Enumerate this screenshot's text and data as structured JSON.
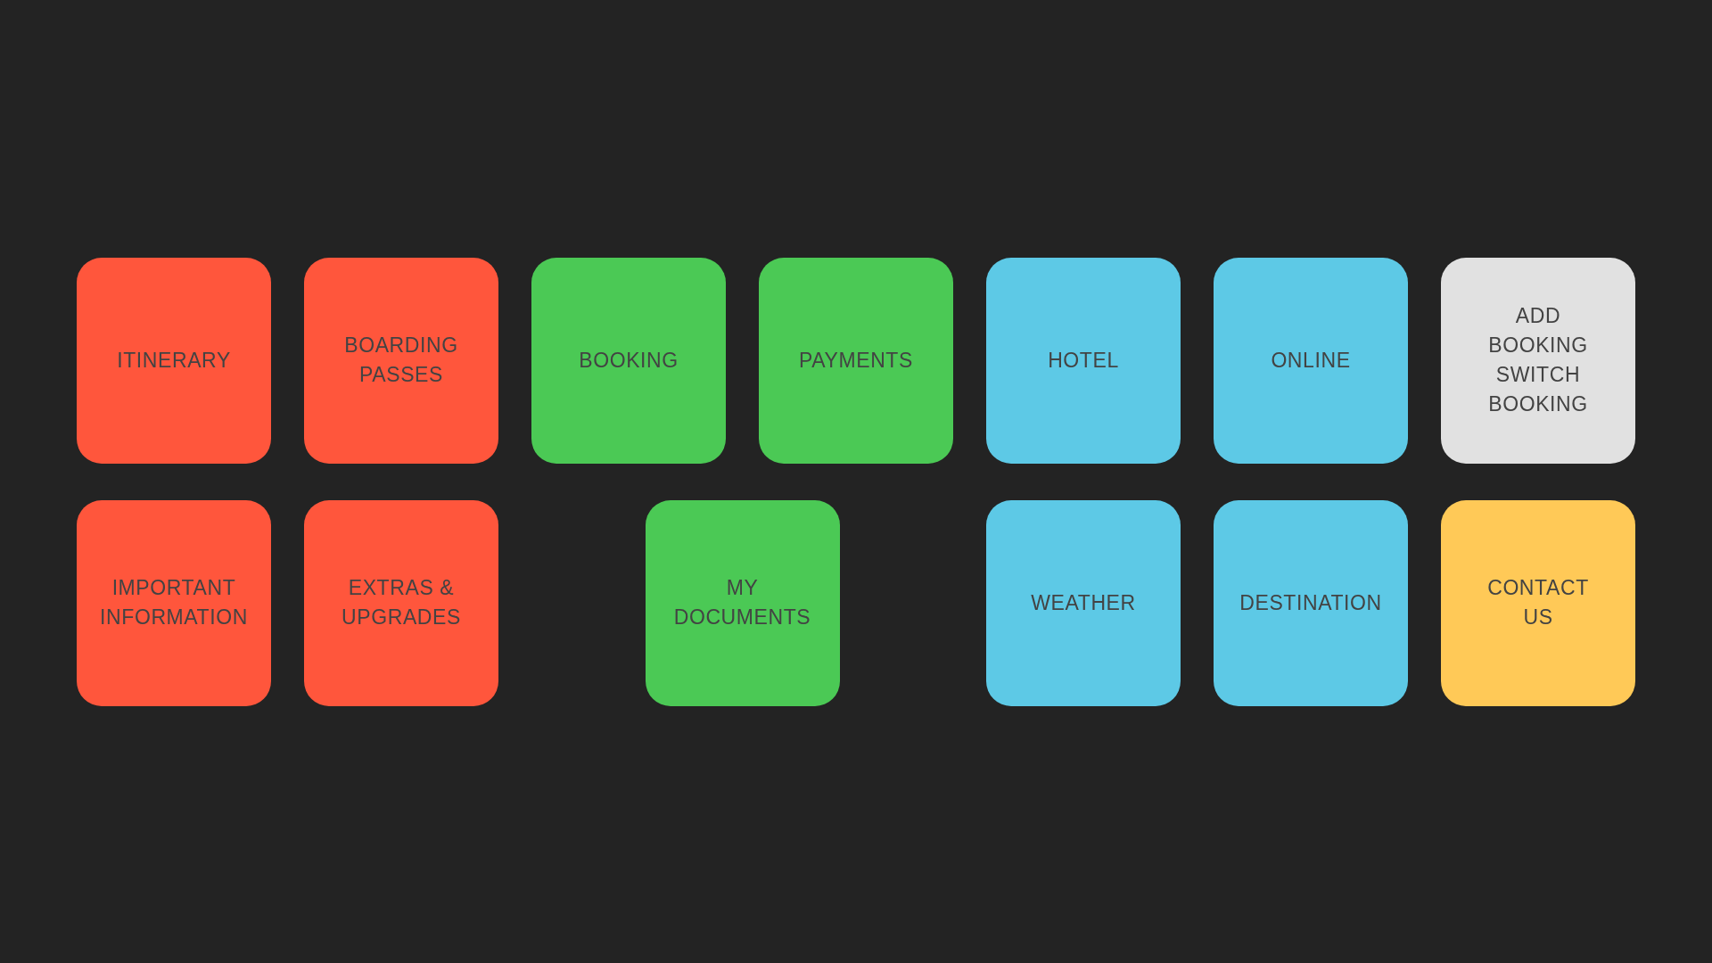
{
  "groups": [
    {
      "rows": [
        [
          {
            "label": "ITINERARY",
            "color": "#ff563c"
          },
          {
            "label": "BOARDING\nPASSES",
            "color": "#ff563c"
          }
        ],
        [
          {
            "label": "IMPORTANT\nINFORMATION",
            "color": "#ff563c"
          },
          {
            "label": "EXTRAS &\nUPGRADES",
            "color": "#ff563c"
          }
        ]
      ]
    },
    {
      "rows": [
        [
          {
            "label": "BOOKING",
            "color": "#4bc955"
          },
          {
            "label": "PAYMENTS",
            "color": "#4bc955"
          }
        ],
        [
          {
            "label": "MY\nDOCUMENTS",
            "color": "#4bc955"
          }
        ]
      ]
    },
    {
      "rows": [
        [
          {
            "label": "HOTEL",
            "color": "#5dc9e6"
          },
          {
            "label": "ONLINE",
            "color": "#5dc9e6"
          }
        ],
        [
          {
            "label": "WEATHER",
            "color": "#5dc9e6"
          },
          {
            "label": "DESTINATION",
            "color": "#5dc9e6"
          }
        ]
      ]
    },
    {
      "rows": [
        [
          {
            "label": "ADD\nBOOKING\nSWITCH\nBOOKING",
            "color": "#e1e1e1"
          }
        ],
        [
          {
            "label": "CONTACT\nUS",
            "color": "#ffc957"
          }
        ]
      ]
    }
  ]
}
